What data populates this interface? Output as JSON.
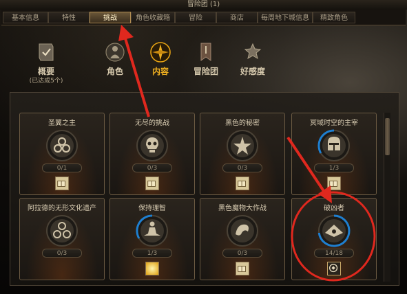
{
  "window": {
    "title": "冒险团 (1)"
  },
  "tabs": [
    {
      "label": "基本信息"
    },
    {
      "label": "特性"
    },
    {
      "label": "挑战"
    },
    {
      "label": "角色收藏箱"
    },
    {
      "label": "冒险"
    },
    {
      "label": "商店"
    },
    {
      "label": "每周地下城信息"
    },
    {
      "label": "精致角色"
    }
  ],
  "nav": [
    {
      "label": "概要",
      "sub": "(已达成5个)",
      "icon": "scroll-check-icon"
    },
    {
      "label": "角色",
      "icon": "character-icon"
    },
    {
      "label": "内容",
      "icon": "compass-icon"
    },
    {
      "label": "冒险团",
      "icon": "banner-icon"
    },
    {
      "label": "好感度",
      "icon": "star-hand-icon"
    }
  ],
  "cards": [
    {
      "title": "圣翼之主",
      "progress": "0/1",
      "progress_fraction": 0,
      "icon": "triquetra-icon",
      "reward": "reward-box-icon"
    },
    {
      "title": "无尽的挑战",
      "progress": "0/3",
      "progress_fraction": 0,
      "icon": "skull-icon",
      "reward": "reward-box-icon"
    },
    {
      "title": "黑色的秘密",
      "progress": "0/3",
      "progress_fraction": 0,
      "icon": "star-emblem-icon",
      "reward": "reward-box-icon"
    },
    {
      "title": "冥域时空的主宰",
      "progress": "1/3",
      "progress_fraction": 0.333,
      "icon": "helmet-icon",
      "reward": "reward-box-icon"
    },
    {
      "title": "阿拉德的无形文化遗产",
      "progress": "0/3",
      "progress_fraction": 0,
      "icon": "spiral-icon",
      "reward": "reward-box-icon"
    },
    {
      "title": "保持理智",
      "progress": "1/3",
      "progress_fraction": 0.333,
      "icon": "meditation-icon",
      "reward": "reward-burst-icon"
    },
    {
      "title": "黑色魔物大作战",
      "progress": "0/3",
      "progress_fraction": 0,
      "icon": "dragon-icon",
      "reward": "reward-box-icon"
    },
    {
      "title": "破凶者",
      "progress": "14/18",
      "progress_fraction": 0.778,
      "icon": "eye-emblem-icon",
      "reward": "reward-medal-icon"
    }
  ],
  "colors": {
    "accent": "#f0b020",
    "ring": "#1e7fd0",
    "annotation": "#e0281e"
  }
}
